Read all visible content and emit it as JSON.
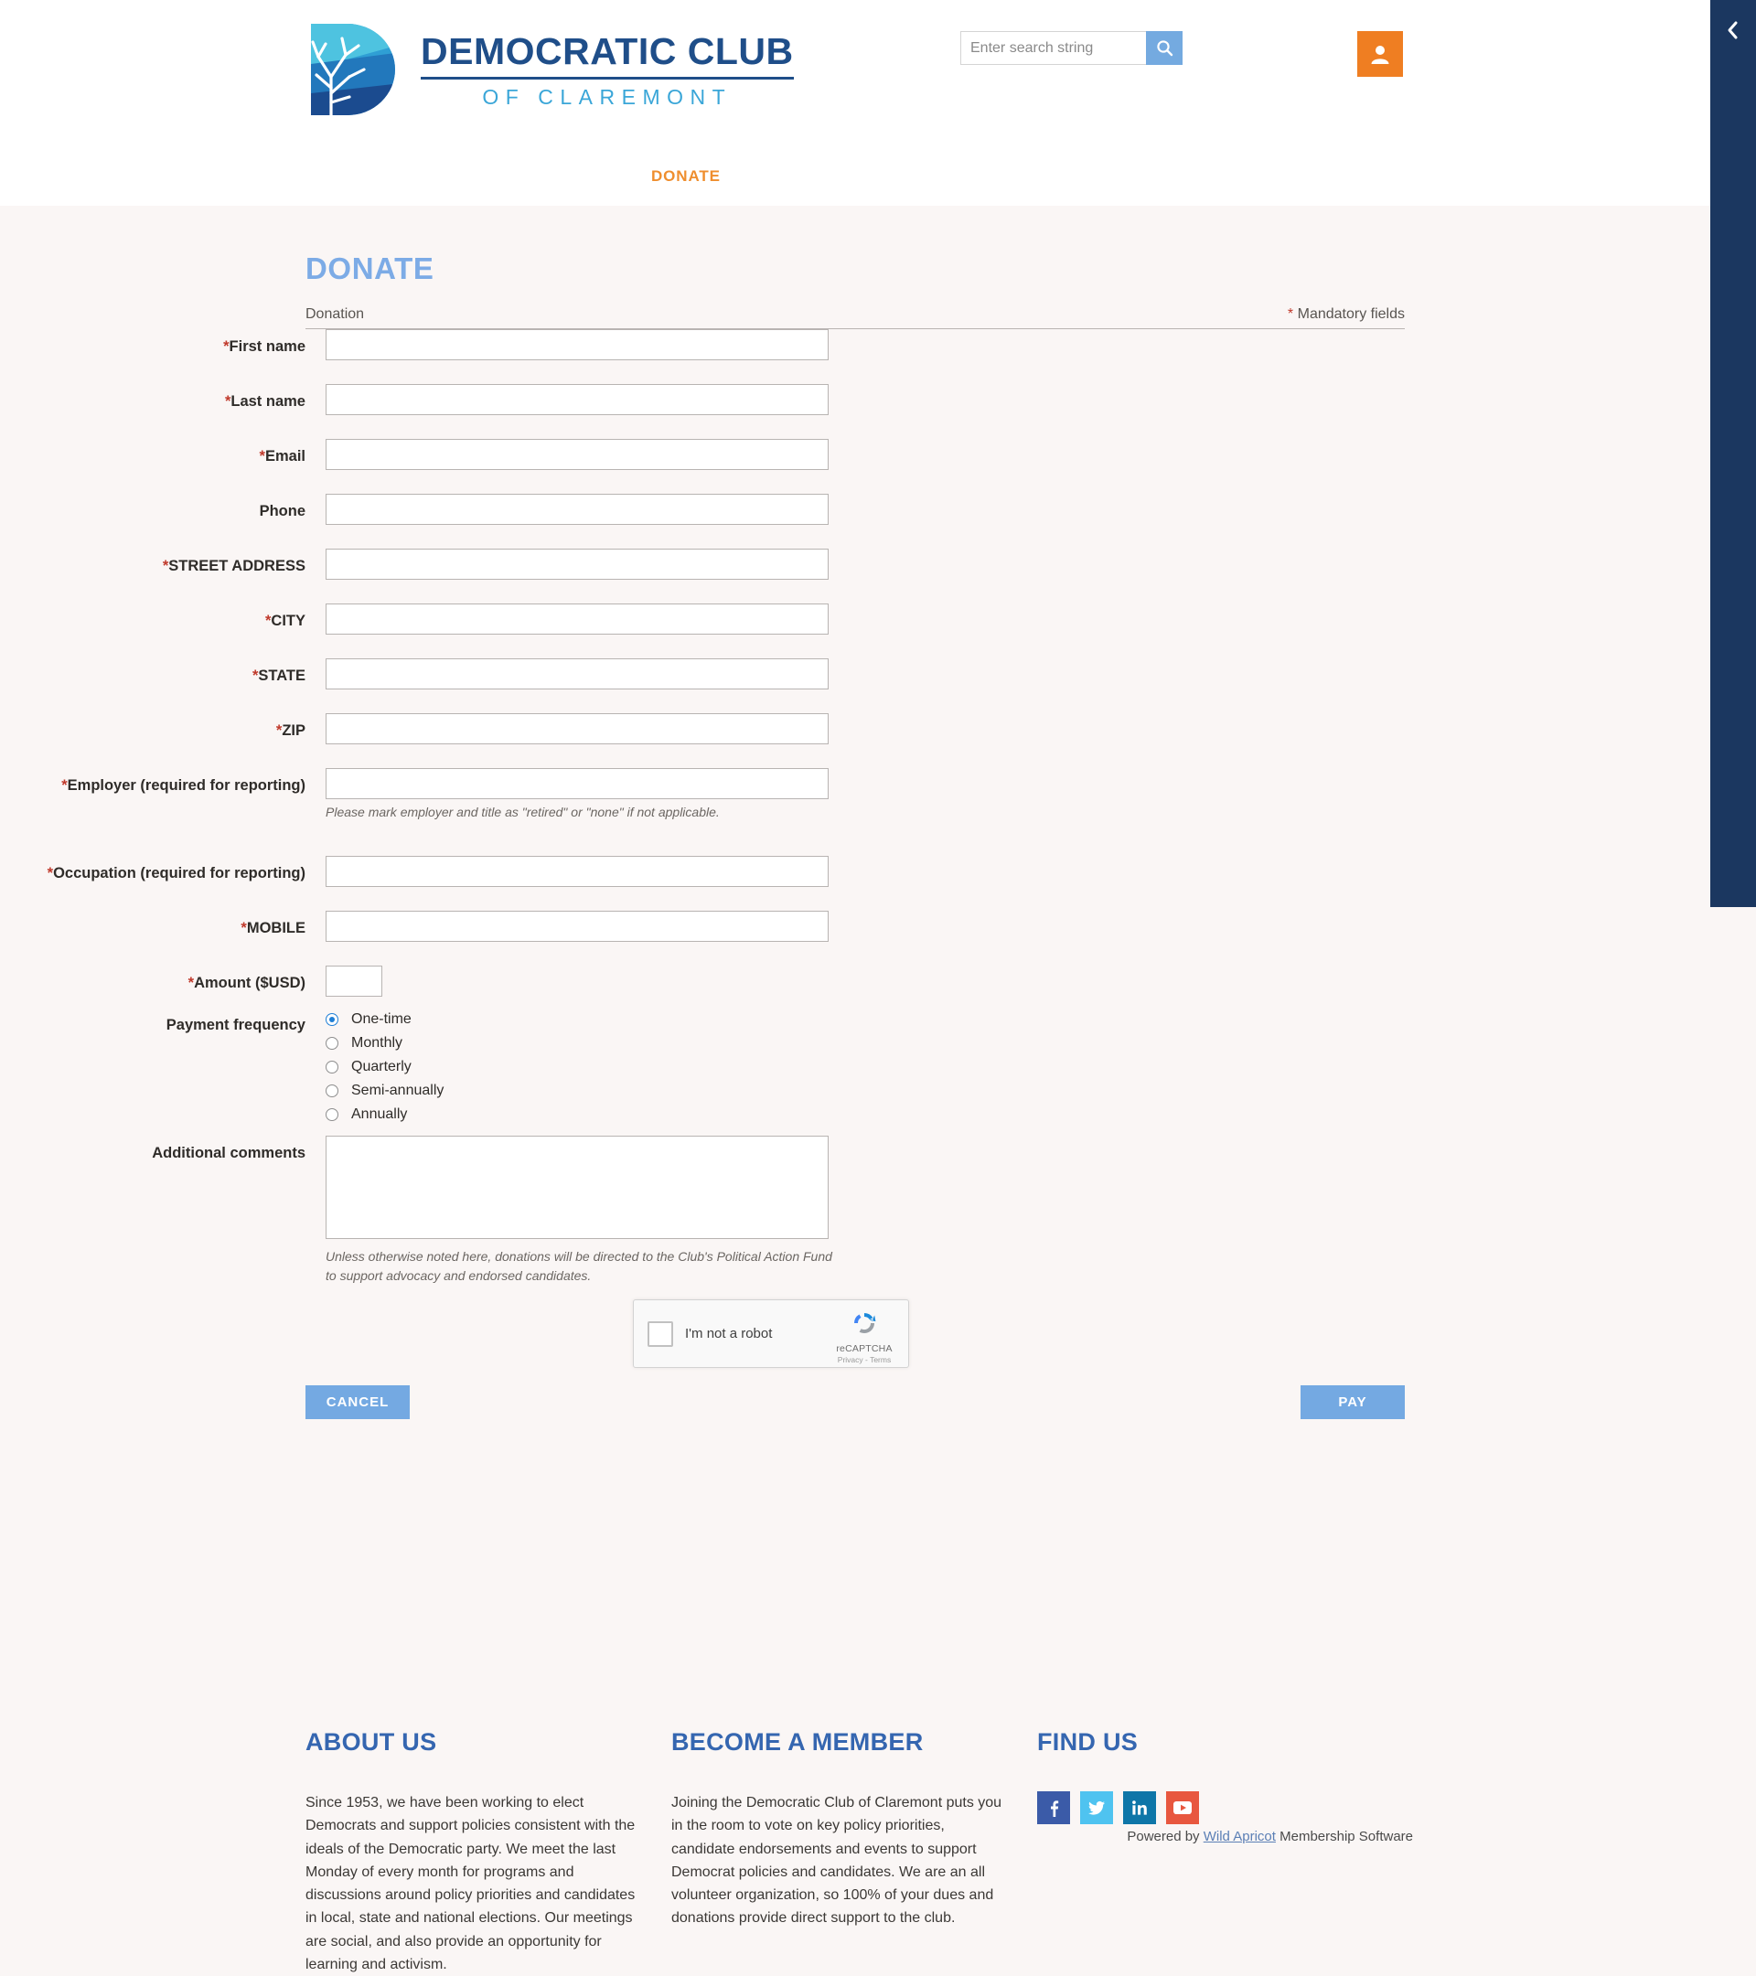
{
  "header": {
    "logo": {
      "title": "DEMOCRATIC CLUB",
      "subtitle": "OF CLAREMONT",
      "mark_name": "tree-circle-logo"
    },
    "search": {
      "placeholder": "Enter search string",
      "value": "",
      "button_icon": "search-icon"
    },
    "account_icon": "user-icon",
    "nav": [
      {
        "label": "DONATE"
      }
    ]
  },
  "right_panel": {
    "toggle_icon": "chevron-left-icon"
  },
  "main": {
    "page_title": "DONATE",
    "section_label": "Donation",
    "mandatory_note": "Mandatory fields",
    "mandatory_star": "*",
    "fields": [
      {
        "label": "First name",
        "required": true,
        "value": "",
        "name": "first-name"
      },
      {
        "label": "Last name",
        "required": true,
        "value": "",
        "name": "last-name"
      },
      {
        "label": "Email",
        "required": true,
        "value": "",
        "name": "email"
      },
      {
        "label": "Phone",
        "required": false,
        "value": "",
        "name": "phone"
      },
      {
        "label": "STREET ADDRESS",
        "required": true,
        "value": "",
        "name": "street-address"
      },
      {
        "label": "CITY",
        "required": true,
        "value": "",
        "name": "city"
      },
      {
        "label": "STATE",
        "required": true,
        "value": "",
        "name": "state"
      },
      {
        "label": "ZIP",
        "required": true,
        "value": "",
        "name": "zip"
      },
      {
        "label": "Employer (required for reporting)",
        "required": true,
        "value": "",
        "name": "employer"
      },
      {
        "label": "Occupation (required for reporting)",
        "required": true,
        "value": "",
        "name": "occupation"
      },
      {
        "label": "MOBILE",
        "required": true,
        "value": "",
        "name": "mobile"
      }
    ],
    "employer_helper": "Please mark employer and title as \"retired\" or \"none\" if not applicable.",
    "amount": {
      "label": "Amount ($USD)",
      "required": true,
      "value": ""
    },
    "payment_frequency": {
      "label": "Payment frequency",
      "options": [
        "One-time",
        "Monthly",
        "Quarterly",
        "Semi-annually",
        "Annually"
      ],
      "selected": "One-time"
    },
    "comments": {
      "label": "Additional comments",
      "value": ""
    },
    "comments_helper": "Unless otherwise noted here, donations will be directed to the Club's Political Action Fund to support advocacy and endorsed candidates.",
    "recaptcha": {
      "text": "I'm not a robot",
      "brand": "reCAPTCHA",
      "links": "Privacy - Terms",
      "checked": false
    },
    "buttons": {
      "cancel": "CANCEL",
      "pay": "PAY"
    }
  },
  "footer": {
    "columns": [
      {
        "title": "ABOUT US",
        "body": "Since 1953, we have been working to elect Democrats and support policies consistent with the ideals of the Democratic party. We meet the last Monday of every month for programs and discussions around policy priorities and candidates in local, state and national elections. Our meetings are social, and also provide an opportunity for learning and activism."
      },
      {
        "title": "BECOME A MEMBER",
        "body": "Joining the Democratic Club of Claremont puts you in the room to vote on key policy priorities, candidate endorsements and events to support Democrat policies and candidates. We are an all volunteer organization, so 100% of your dues and donations provide direct support to the club."
      },
      {
        "title": "FIND US",
        "body": ""
      }
    ],
    "socials": [
      {
        "name": "facebook-icon",
        "color": "#3b5ba8"
      },
      {
        "name": "twitter-icon",
        "color": "#4fc3f0"
      },
      {
        "name": "linkedin-icon",
        "color": "#0e76a8"
      },
      {
        "name": "youtube-icon",
        "color": "#e8573f"
      }
    ],
    "powered_prefix": "Powered by ",
    "powered_link": "Wild Apricot",
    "powered_suffix": " Membership Software"
  },
  "colors": {
    "brand_navy": "#1f4e89",
    "brand_light_blue": "#3aa6d8",
    "accent_orange": "#ef7e22",
    "button_blue": "#74a9e2",
    "panel_navy": "#1b3760",
    "page_bg": "#faf6f5",
    "required_red": "#c0392b"
  }
}
